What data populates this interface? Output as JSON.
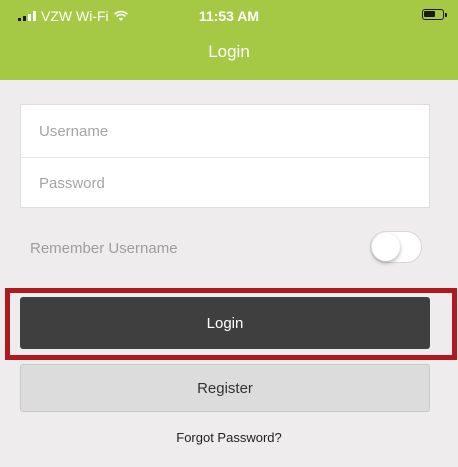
{
  "status_bar": {
    "carrier": "VZW Wi-Fi",
    "time": "11:53 AM",
    "icons": [
      "signal-icon",
      "wifi-icon",
      "battery-icon"
    ]
  },
  "header": {
    "title": "Login"
  },
  "form": {
    "username_placeholder": "Username",
    "username_value": "",
    "password_placeholder": "Password",
    "password_value": "",
    "remember_label": "Remember Username",
    "remember_on": false
  },
  "actions": {
    "login_label": "Login",
    "register_label": "Register",
    "forgot_label": "Forgot Password?"
  },
  "colors": {
    "header": "#a6c945",
    "login_button": "#3f3f3f",
    "register_button": "#dcdcdc",
    "highlight": "#b0191e",
    "background": "#eeecec"
  }
}
